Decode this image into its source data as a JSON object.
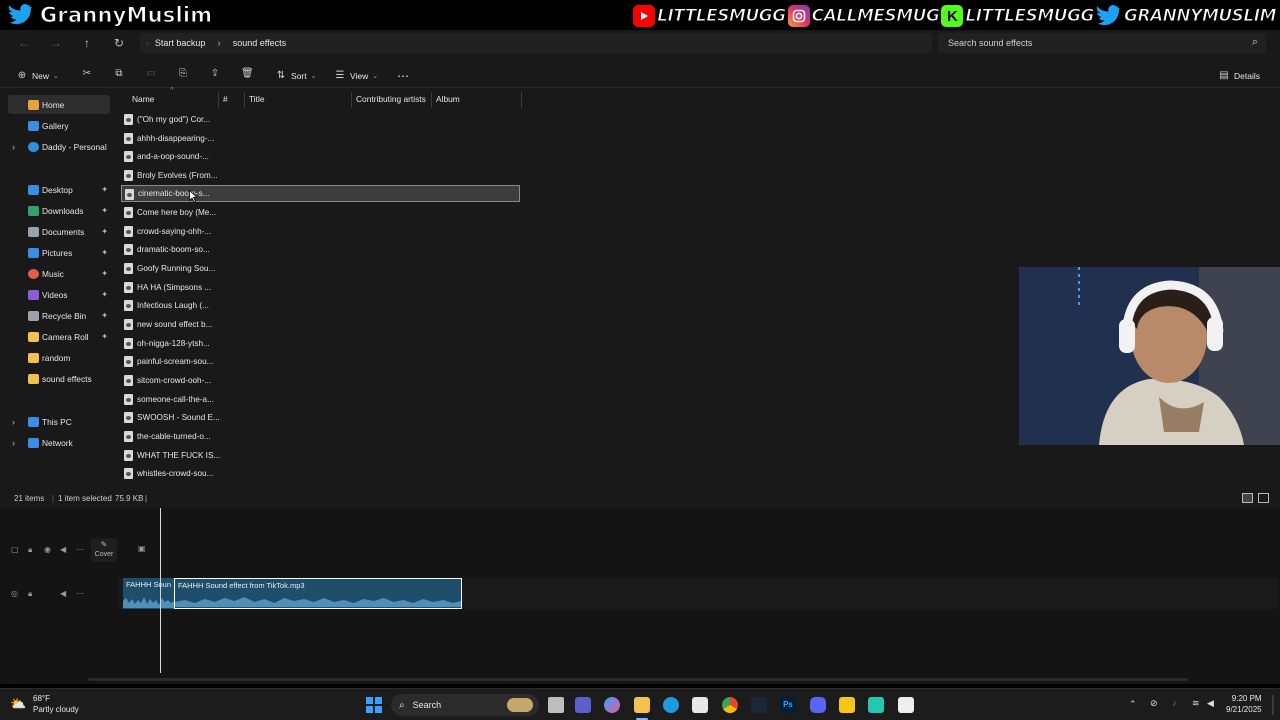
{
  "overlay": {
    "channel_name": "GrannyMuslim",
    "handles": [
      {
        "platform": "youtube",
        "icon": "youtube-icon",
        "color": "#ff0000",
        "text": "LITTLESMUGG"
      },
      {
        "platform": "instagram",
        "icon": "instagram-icon",
        "color": "#e1306c",
        "text": "CALLMESMUG"
      },
      {
        "platform": "kick",
        "icon": "kick-icon",
        "color": "#53fc18",
        "text": "LITTLESMUGG"
      },
      {
        "platform": "twitter",
        "icon": "twitter-icon",
        "color": "#1da1f2",
        "text": "GRANNYMUSLIM"
      }
    ]
  },
  "explorer": {
    "breadcrumb": [
      "Start backup",
      "sound effects"
    ],
    "search_placeholder": "Search sound effects",
    "toolbar": {
      "new_label": "New",
      "sort_label": "Sort",
      "view_label": "View",
      "details_label": "Details"
    },
    "sidebar": {
      "items": [
        {
          "label": "Home",
          "icon": "home-icon",
          "color": "#e8a33c"
        },
        {
          "label": "Gallery",
          "icon": "gallery-icon",
          "color": "#3a8ee6"
        },
        {
          "label": "Daddy - Personal",
          "icon": "onedrive-icon",
          "color": "#2f8fe0"
        },
        {
          "label": "Desktop",
          "icon": "desktop-icon",
          "color": "#3a8ee6"
        },
        {
          "label": "Downloads",
          "icon": "downloads-icon",
          "color": "#2fa36b"
        },
        {
          "label": "Documents",
          "icon": "documents-icon",
          "color": "#9aa3ad"
        },
        {
          "label": "Pictures",
          "icon": "pictures-icon",
          "color": "#3a8ee6"
        },
        {
          "label": "Music",
          "icon": "music-icon",
          "color": "#e35d4f"
        },
        {
          "label": "Videos",
          "icon": "videos-icon",
          "color": "#8a5cd6"
        },
        {
          "label": "Recycle Bin",
          "icon": "recycle-bin-icon",
          "color": "#9aa3ad"
        },
        {
          "label": "Camera Roll",
          "icon": "folder-icon",
          "color": "#f2c14e"
        },
        {
          "label": "random",
          "icon": "folder-icon",
          "color": "#f2c14e"
        },
        {
          "label": "sound effects",
          "icon": "folder-icon",
          "color": "#f2c14e"
        },
        {
          "label": "This PC",
          "icon": "this-pc-icon",
          "color": "#3a8ee6"
        },
        {
          "label": "Network",
          "icon": "network-icon",
          "color": "#3a8ee6"
        }
      ]
    },
    "columns": [
      "Name",
      "#",
      "Title",
      "Contributing artists",
      "Album"
    ],
    "files": [
      "(\"Oh my god\") Cor...",
      "ahhh-disappearing-...",
      "and-a-oop-sound-...",
      "Broly Evolves (From...",
      "cinematic-boom-s...",
      "Come here boy (Me...",
      "crowd-saying-ohh-...",
      "dramatic-boom-so...",
      "Goofy Running Sou...",
      "HA HA (Simpsons ...",
      "Infectious Laugh (...",
      "new sound effect b...",
      "oh-nigga-128-ytsh...",
      "painful-scream-sou...",
      "sitcom-crowd-ooh-...",
      "someone-call-the-a...",
      "SWOOSH - Sound E...",
      "the-cable-turned-o...",
      "WHAT THE FUCK IS...",
      "whistles-crowd-sou..."
    ],
    "selected_index": 4,
    "status": {
      "items": "21 items",
      "selected": "1 item selected",
      "size": "75.9 KB"
    }
  },
  "editor": {
    "cover_label": "Cover",
    "clips": [
      {
        "label": "FAHHH Soun"
      },
      {
        "label": "FAHHH Sound effect from TikTok.mp3"
      }
    ],
    "clip_color": "#1f4e6b"
  },
  "taskbar": {
    "weather_temp": "68°F",
    "weather_desc": "Partly cloudy",
    "search_label": "Search",
    "time": "9:20 PM",
    "date": "9/21/2025"
  }
}
